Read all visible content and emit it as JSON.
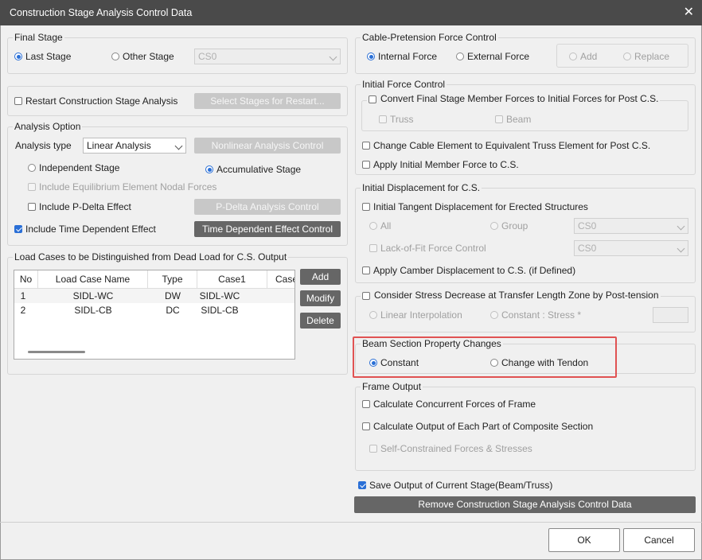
{
  "window": {
    "title": "Construction Stage Analysis Control Data"
  },
  "final_stage": {
    "legend": "Final Stage",
    "last_stage": "Last Stage",
    "other_stage": "Other Stage",
    "stage_select": "CS0"
  },
  "restart": {
    "label": "Restart Construction Stage Analysis",
    "button": "Select Stages for Restart..."
  },
  "analysis_option": {
    "legend": "Analysis Option",
    "type_label": "Analysis type",
    "type_value": "Linear Analysis",
    "nonlinear_button": "Nonlinear Analysis Control",
    "independent": "Independent Stage",
    "accumulative": "Accumulative Stage",
    "equilibrium": "Include Equilibrium Element Nodal Forces",
    "pdelta": "Include P-Delta Effect",
    "pdelta_button": "P-Delta Analysis Control",
    "time_dep": "Include Time Dependent Effect",
    "time_dep_button": "Time Dependent Effect Control"
  },
  "load_cases": {
    "legend": "Load Cases to be Distinguished from Dead Load for C.S. Output",
    "columns": [
      "No",
      "Load Case Name",
      "Type",
      "Case1",
      "Case"
    ],
    "rows": [
      [
        "1",
        "SIDL-WC",
        "DW",
        "SIDL-WC"
      ],
      [
        "2",
        "SIDL-CB",
        "DC",
        "SIDL-CB"
      ]
    ],
    "add": "Add",
    "modify": "Modify",
    "delete": "Delete"
  },
  "cable": {
    "legend": "Cable-Pretension Force Control",
    "internal": "Internal Force",
    "external": "External Force",
    "add": "Add",
    "replace": "Replace"
  },
  "initial_force": {
    "legend": "Initial Force Control",
    "convert": "Convert Final Stage Member Forces to Initial Forces for Post C.S.",
    "truss": "Truss",
    "beam": "Beam",
    "cable_truss": "Change Cable Element to Equivalent Truss Element for Post C.S.",
    "apply_initial": "Apply Initial Member Force to C.S."
  },
  "initial_disp": {
    "legend": "Initial Displacement for C.S.",
    "tangent": "Initial Tangent Displacement for Erected Structures",
    "all": "All",
    "group": "Group",
    "group_select": "CS0",
    "lack_of_fit": "Lack-of-Fit Force Control",
    "lof_select": "CS0",
    "camber": "Apply Camber Displacement to C.S. (if Defined)"
  },
  "stress_decrease": {
    "label": "Consider Stress Decrease at Transfer Length Zone by Post-tension",
    "linear": "Linear Interpolation",
    "constant": "Constant : Stress *"
  },
  "beam_section": {
    "legend": "Beam Section Property Changes",
    "constant": "Constant",
    "change": "Change with Tendon"
  },
  "frame_output": {
    "legend": "Frame Output",
    "concurrent": "Calculate Concurrent Forces of Frame",
    "composite": "Calculate Output of Each Part of Composite Section",
    "self": "Self-Constrained Forces & Stresses"
  },
  "save_output": "Save Output of Current Stage(Beam/Truss)",
  "remove_button": "Remove Construction Stage Analysis Control Data",
  "ok": "OK",
  "cancel": "Cancel"
}
